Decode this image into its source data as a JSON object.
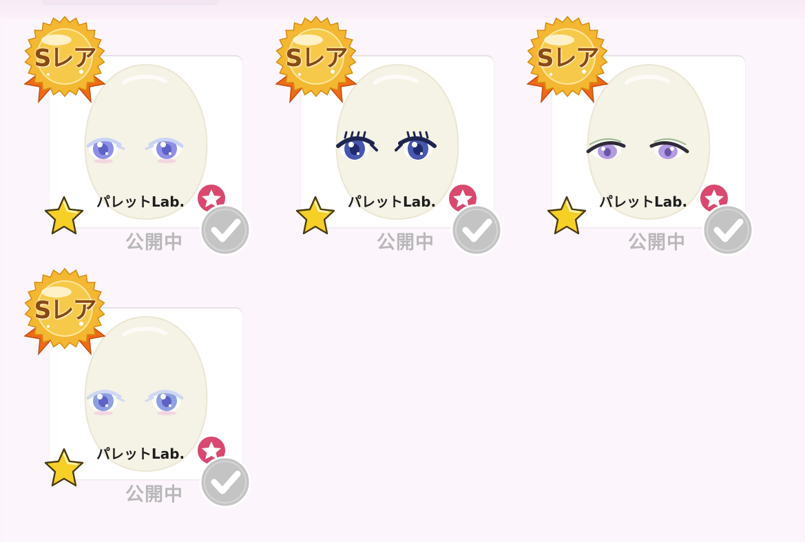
{
  "items": [
    {
      "rarity_label": "Sレア",
      "brand": "パレットLab.",
      "status": "公開中",
      "eye_style": "lilac-round",
      "iris_color": "#8f8fe6",
      "lash_color": "#c9d4f4"
    },
    {
      "rarity_label": "Sレア",
      "brand": "パレットLab.",
      "status": "公開中",
      "eye_style": "navy-lashes",
      "iris_color": "#4756ae",
      "lash_color": "#1d254f"
    },
    {
      "rarity_label": "Sレア",
      "brand": "パレットLab.",
      "status": "公開中",
      "eye_style": "violet-halflid",
      "iris_color": "#b49be0",
      "lash_color": "#2e2a38"
    },
    {
      "rarity_label": "Sレア",
      "brand": "パレットLab.",
      "status": "公開中",
      "eye_style": "pale-blue-round",
      "iris_color": "#8fa0e0",
      "lash_color": "#cfd8f3"
    }
  ],
  "colors": {
    "medal_gold": "#f2b32a",
    "ribbon_orange": "#ef6a17",
    "badge_pink": "#d9486f",
    "favorite_star": "#f6cf27",
    "check_grey": "#bdbdbd"
  },
  "icons": {
    "medal": "rarity-medal-icon",
    "favorite": "star-icon",
    "brand_badge": "pink-star-badge-icon",
    "owned": "checkmark-icon"
  }
}
